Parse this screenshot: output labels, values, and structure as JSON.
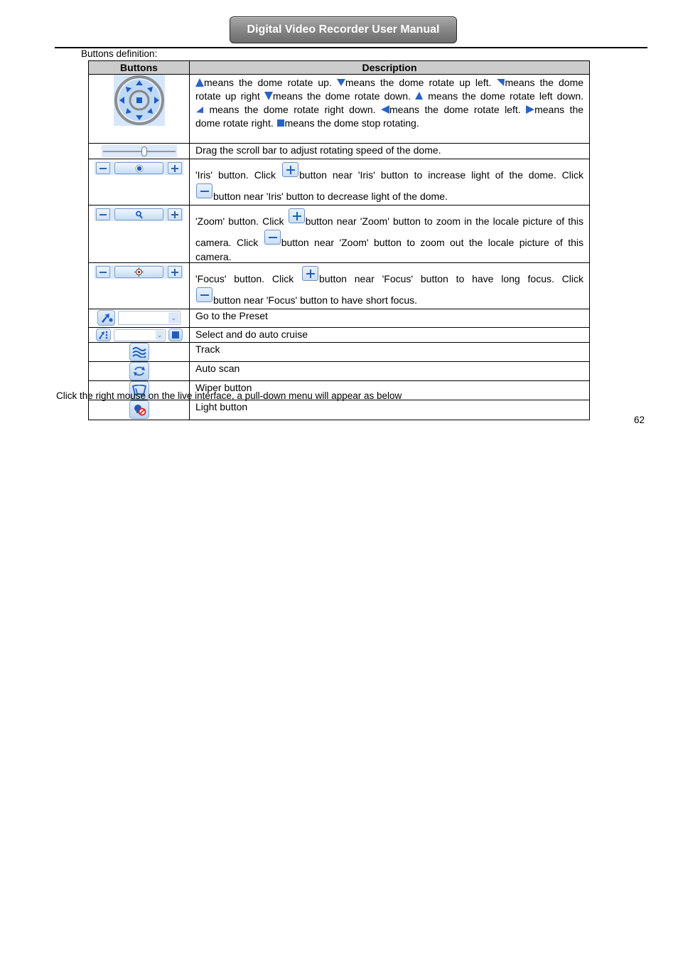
{
  "header": {
    "title": "Digital Video Recorder User Manual"
  },
  "intro": "Buttons definition:",
  "table": {
    "columns": [
      "Buttons",
      "Description"
    ],
    "rows": [
      {
        "icon": "ptz-direction-pad-icon",
        "description_parts": {
          "up": "means the dome rotate up.",
          "up_left": "means the dome   rotate up left.",
          "up_right_a": "means the dome",
          "up_right_b": "rotate up right",
          "down": "means the dome rotate down.",
          "left_down": " means the dome   rotate left down.",
          "right_down": " means the dome   rotate right down.",
          "left": "means the dome rotate left.",
          "right_a": "means the",
          "right_b": "dome rotate right.",
          "stop": "means the dome stop rotating."
        }
      },
      {
        "icon": "speed-slider-icon",
        "description": "Drag the scroll bar to adjust rotating speed of the dome."
      },
      {
        "icon": "iris-control-icon",
        "d1": "'Iris' button. Click",
        "d2": "button near 'Iris' button to increase light of the dome. Click",
        "d3": "button near 'Iris' button to decrease light of the dome."
      },
      {
        "icon": "zoom-control-icon",
        "d1": "'Zoom' button. Click",
        "d2": "button near 'Zoom' button to zoom in the locale picture of this",
        "d3": "camera. Click",
        "d4": "button near 'Zoom' button to zoom out the locale picture of this",
        "d5": "camera."
      },
      {
        "icon": "focus-control-icon",
        "d1": "'Focus' button. Click",
        "d2": "button near 'Focus' button to have long focus. Click",
        "d3": "button near 'Focus' button to have short focus."
      },
      {
        "icon": "preset-goto-icon",
        "description": "Go to the Preset",
        "dropdown_value": ""
      },
      {
        "icon": "auto-cruise-icon",
        "description": "Select and do auto cruise",
        "dropdown_value": ""
      },
      {
        "icon": "track-icon",
        "description": "Track"
      },
      {
        "icon": "auto-scan-icon",
        "description": "Auto scan"
      },
      {
        "icon": "wiper-icon",
        "description": "Wiper button"
      },
      {
        "icon": "light-icon",
        "description": "Light button"
      }
    ]
  },
  "bottom_text": "Click the right mouse on the live interface, a pull-down menu will appear as below",
  "page_number": "62",
  "colors": {
    "accent_blue": "#1f5fb8",
    "header_gray": "#8a8a8a",
    "table_header_bg": "#cccccc"
  }
}
